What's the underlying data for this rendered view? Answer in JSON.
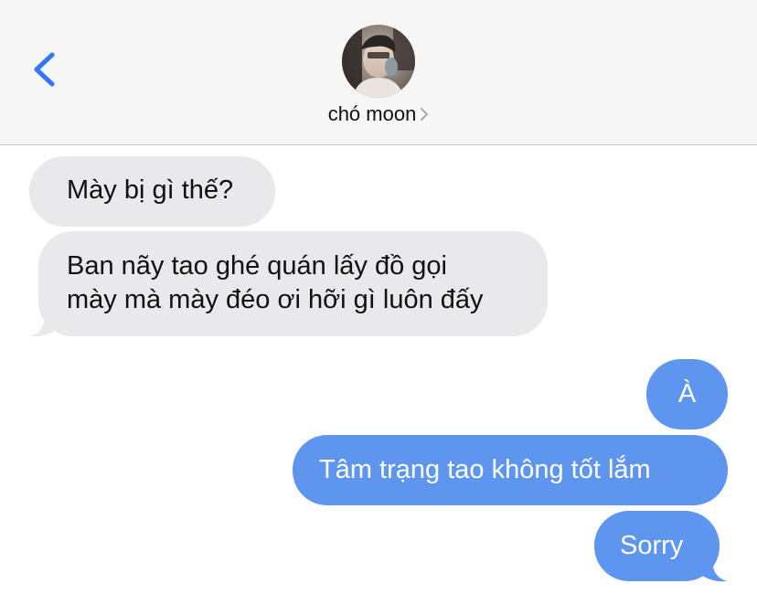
{
  "header": {
    "contact_name": "chó moon",
    "avatar_label": "contact avatar"
  },
  "messages": [
    {
      "from": "contact",
      "text": "Mày bị gì thế?"
    },
    {
      "from": "contact",
      "text_lines": [
        "Ban nãy tao ghé quán lấy đồ gọi",
        "mày mà mày đéo ơi hỡi gì luôn đấy"
      ]
    },
    {
      "from": "me",
      "text": "À"
    },
    {
      "from": "me",
      "text": "Tâm trạng tao không tốt lắm"
    },
    {
      "from": "me",
      "text": "Sorry"
    }
  ],
  "colors": {
    "accent": "#3478f6",
    "sent_bubble": "#5e95ee",
    "received_bubble": "#e9e9eb",
    "header_bg": "#f6f6f6"
  }
}
